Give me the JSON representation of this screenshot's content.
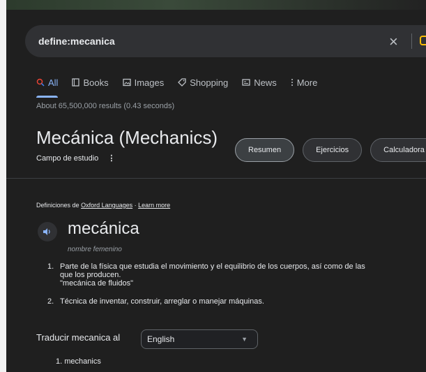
{
  "search": {
    "query": "define:mecanica"
  },
  "tabs": [
    {
      "label": "All",
      "icon": "search-icon"
    },
    {
      "label": "Books",
      "icon": "book-icon"
    },
    {
      "label": "Images",
      "icon": "image-icon"
    },
    {
      "label": "Shopping",
      "icon": "tag-icon"
    },
    {
      "label": "News",
      "icon": "newspaper-icon"
    },
    {
      "label": "More",
      "icon": "more-vert-icon"
    }
  ],
  "results_stats": "About 65,500,000 results (0.43 seconds)",
  "entity": {
    "title": "Mecánica (Mechanics)",
    "subtitle": "Campo de estudio",
    "chips": [
      "Resumen",
      "Ejercicios",
      "Calculadora"
    ]
  },
  "definition": {
    "source_prefix": "Definiciones de",
    "source_name": "Oxford Languages",
    "source_sep": " · ",
    "learn_more": "Learn more",
    "word": "mecánica",
    "part_of_speech": "nombre femenino",
    "senses": [
      {
        "number": "1.",
        "text": "Parte de la física que estudia el movimiento y el equilibrio de los cuerpos, así como de las",
        "text_cont": "que los producen.",
        "example": "\"mecánica de fluidos\""
      },
      {
        "number": "2.",
        "text": "Técnica de inventar, construir, arreglar o manejar máquinas."
      }
    ]
  },
  "translate": {
    "label": "Traducir mecanica al",
    "language": "English",
    "results": [
      {
        "number": "1.",
        "text": "mechanics"
      }
    ]
  },
  "colors": {
    "accent": "#8ab4f8",
    "background": "#1f1f1f",
    "surface": "#303134"
  }
}
